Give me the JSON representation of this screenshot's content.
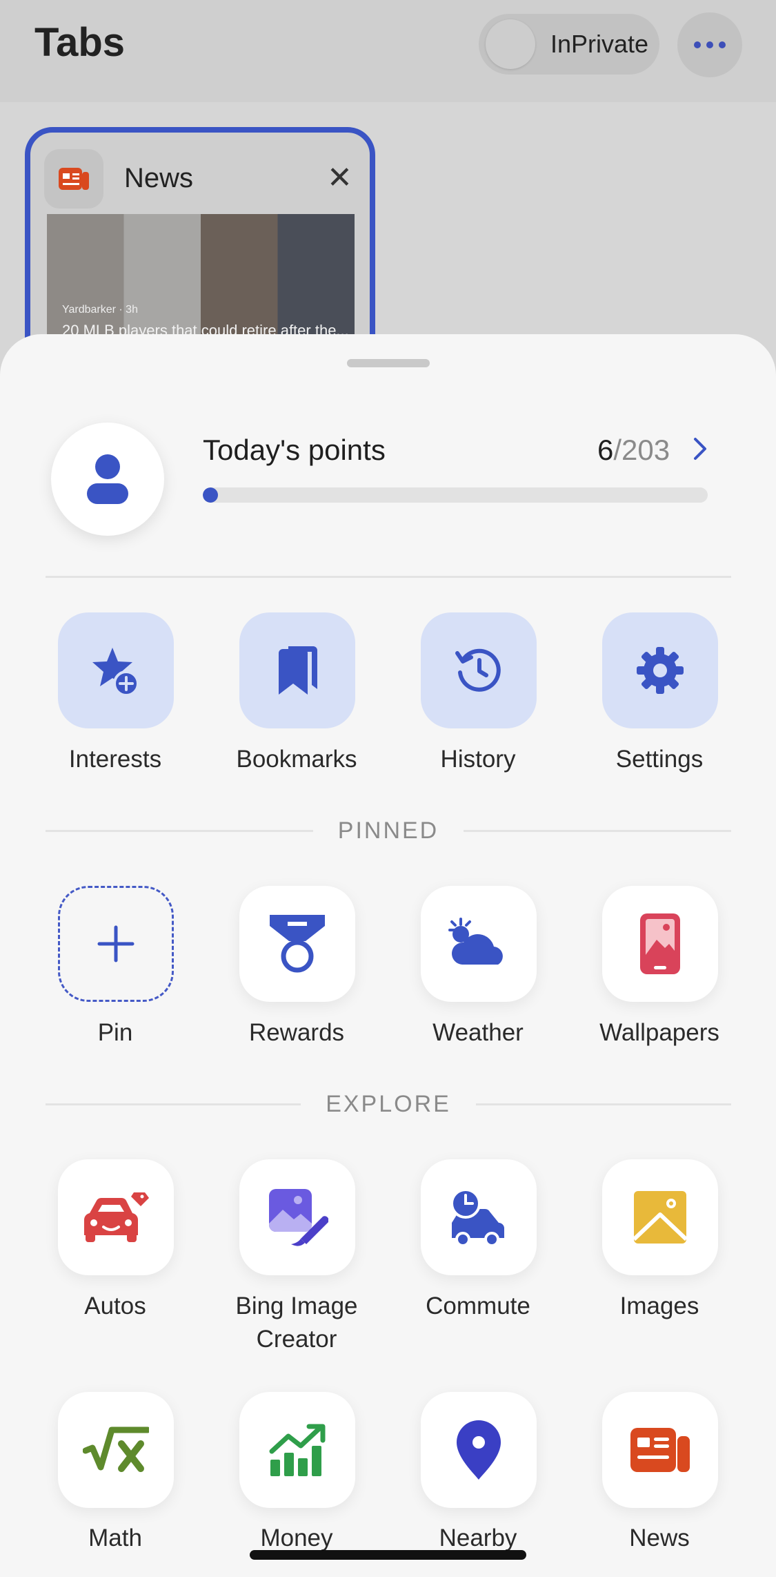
{
  "header": {
    "title": "Tabs",
    "inprivate_label": "InPrivate"
  },
  "tab": {
    "title": "News",
    "thumb_source": "Yardbarker · 3h",
    "thumb_headline": "20 MLB players that could retire after the..."
  },
  "points": {
    "label": "Today's points",
    "current": "6",
    "separator": "/",
    "total": "203",
    "progress_fraction": 0.03
  },
  "quick_actions": [
    {
      "label": "Interests",
      "icon": "star-plus-icon"
    },
    {
      "label": "Bookmarks",
      "icon": "bookmarks-icon"
    },
    {
      "label": "History",
      "icon": "history-icon"
    },
    {
      "label": "Settings",
      "icon": "gear-icon"
    }
  ],
  "pinned": {
    "heading": "PINNED",
    "items": [
      {
        "label": "Pin",
        "icon": "plus-icon"
      },
      {
        "label": "Rewards",
        "icon": "medal-icon"
      },
      {
        "label": "Weather",
        "icon": "weather-icon"
      },
      {
        "label": "Wallpapers",
        "icon": "wallpaper-icon"
      }
    ]
  },
  "explore": {
    "heading": "EXPLORE",
    "items": [
      {
        "label": "Autos",
        "icon": "car-tag-icon"
      },
      {
        "label": "Bing Image\nCreator",
        "icon": "image-creator-icon"
      },
      {
        "label": "Commute",
        "icon": "commute-icon"
      },
      {
        "label": "Images",
        "icon": "image-icon"
      },
      {
        "label": "Math",
        "icon": "math-icon"
      },
      {
        "label": "Money",
        "icon": "money-icon"
      },
      {
        "label": "Nearby",
        "icon": "location-pin-icon"
      },
      {
        "label": "News",
        "icon": "news-icon"
      }
    ]
  },
  "colors": {
    "accent": "#3a54c4",
    "tile_blue_bg": "#d7e0f7",
    "autos": "#d94343",
    "images": "#e8b93a",
    "math": "#5e8a2c",
    "money": "#2f9e4a",
    "news": "#d9491f"
  }
}
